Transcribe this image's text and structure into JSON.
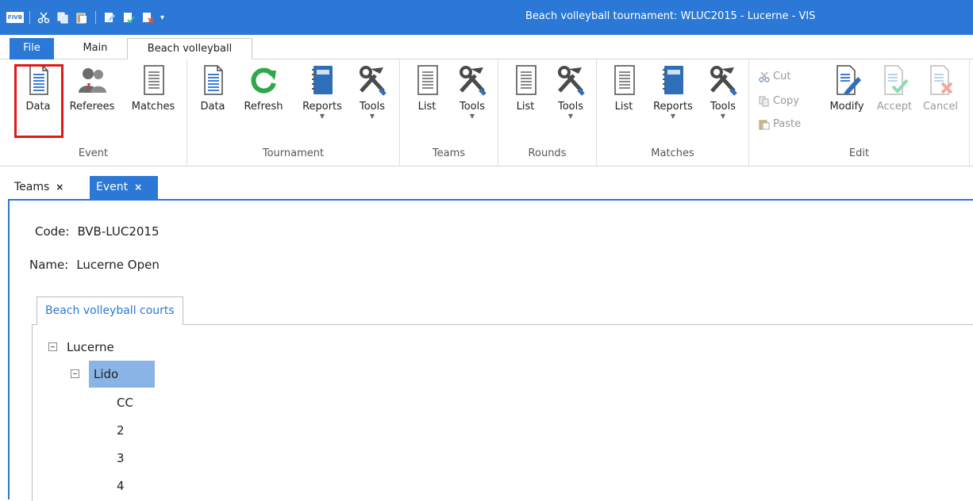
{
  "window": {
    "title": "Beach volleyball tournament: WLUC2015 - Lucerne - VIS",
    "logo_text": "FIVB"
  },
  "ribbon_tabs": [
    "File",
    "Main",
    "Beach volleyball"
  ],
  "ribbon": {
    "event": {
      "label": "Event",
      "buttons": [
        "Data",
        "Referees",
        "Matches"
      ]
    },
    "tournament": {
      "label": "Tournament",
      "buttons": [
        "Data",
        "Refresh",
        "Reports",
        "Tools"
      ]
    },
    "teams": {
      "label": "Teams",
      "buttons": [
        "List",
        "Tools"
      ]
    },
    "rounds": {
      "label": "Rounds",
      "buttons": [
        "List",
        "Tools"
      ]
    },
    "matches": {
      "label": "Matches",
      "buttons": [
        "List",
        "Reports",
        "Tools"
      ]
    },
    "edit": {
      "label": "Edit",
      "cut": "Cut",
      "copy": "Copy",
      "paste": "Paste",
      "buttons": [
        "Modify",
        "Accept",
        "Cancel"
      ]
    }
  },
  "doc_tabs": [
    {
      "label": "Teams",
      "close": "×"
    },
    {
      "label": "Event",
      "close": "×"
    }
  ],
  "event_form": {
    "code_label": "Code:",
    "code_value": "BVB-LUC2015",
    "name_label": "Name:",
    "name_value": "Lucerne Open"
  },
  "inner_tab": "Beach volleyball courts",
  "tree": {
    "root": "Lucerne",
    "child": "Lido",
    "courts": [
      "CC",
      "2",
      "3",
      "4"
    ]
  },
  "colors": {
    "accent": "#2b78d6",
    "highlight": "#e01818",
    "selection": "#8ab4e6"
  }
}
